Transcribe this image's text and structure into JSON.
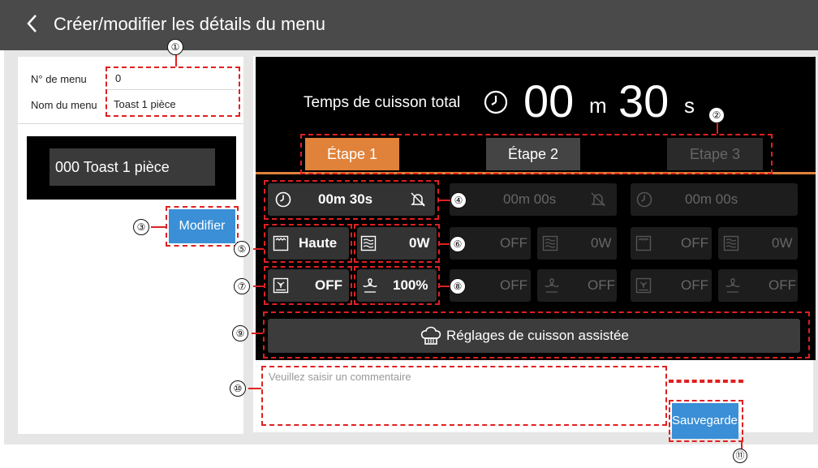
{
  "header": {
    "title": "Créer/modifier les détails du menu"
  },
  "left": {
    "menu_number_label": "N° de menu",
    "menu_number_value": "0",
    "menu_name_label": "Nom du menu",
    "menu_name_value": "Toast 1 pièce",
    "preview": "000 Toast 1 pièce",
    "modify_button": "Modifier"
  },
  "total": {
    "label": "Temps de cuisson total",
    "minutes": "00",
    "m_unit": "m",
    "seconds": "30",
    "s_unit": "s"
  },
  "tabs": [
    {
      "label": "Étape 1",
      "state": "active"
    },
    {
      "label": "Étape 2",
      "state": "normal"
    },
    {
      "label": "Etape 3",
      "state": "disabled"
    }
  ],
  "steps": [
    {
      "time": "00m 30s",
      "top_heat": "Haute",
      "microwave": "0W",
      "bottom_heat": "OFF",
      "fan": "100%"
    },
    {
      "time": "00m 00s",
      "top_heat": "OFF",
      "microwave": "0W",
      "bottom_heat": "OFF",
      "fan": "OFF"
    },
    {
      "time": "00m 00s",
      "top_heat": "OFF",
      "microwave": "0W",
      "bottom_heat": "OFF",
      "fan": "OFF"
    }
  ],
  "assist_button": "Réglages de cuisson assistée",
  "comment_placeholder": "Veuillez saisir un commentaire",
  "save_button": "Sauvegarder",
  "callouts": [
    "①",
    "②",
    "③",
    "④",
    "⑤",
    "⑥",
    "⑦",
    "⑧",
    "⑨",
    "⑩",
    "⑪"
  ],
  "colors": {
    "header": "#4a4a4a",
    "accent": "#e0823a",
    "button": "#3a8fd6",
    "callout": "#e02020"
  },
  "icons": [
    "back-chevron-icon",
    "clock-icon",
    "bell-off-icon",
    "top-heater-icon",
    "microwave-icon",
    "bottom-heater-icon",
    "fan-icon",
    "chef-hat-icon"
  ]
}
